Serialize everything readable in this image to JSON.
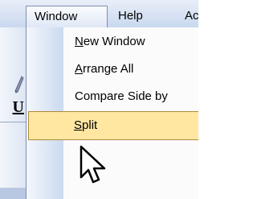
{
  "menubar": {
    "window_label": "Window",
    "help_label": "Help",
    "next_label": "Ac"
  },
  "toolbar": {
    "underline_glyph": "U"
  },
  "window_menu": {
    "items": [
      {
        "label": "New Window",
        "mnemonic": "N"
      },
      {
        "label": "Arrange All",
        "mnemonic": "A"
      },
      {
        "label": "Compare Side by Side",
        "visible_text": "Compare Side by"
      },
      {
        "label": "Split",
        "mnemonic": "S",
        "highlighted": true
      }
    ]
  },
  "colors": {
    "highlight_fill": "#ffe7a2",
    "highlight_border": "#ad8a3b",
    "menubar_top": "#e9eef8",
    "gutter": "#cbdaf0"
  },
  "icons": {
    "cursor": "mouse-pointer-icon",
    "toolbar_edit": "pencil-icon",
    "toolbar_underline": "underline-icon"
  }
}
